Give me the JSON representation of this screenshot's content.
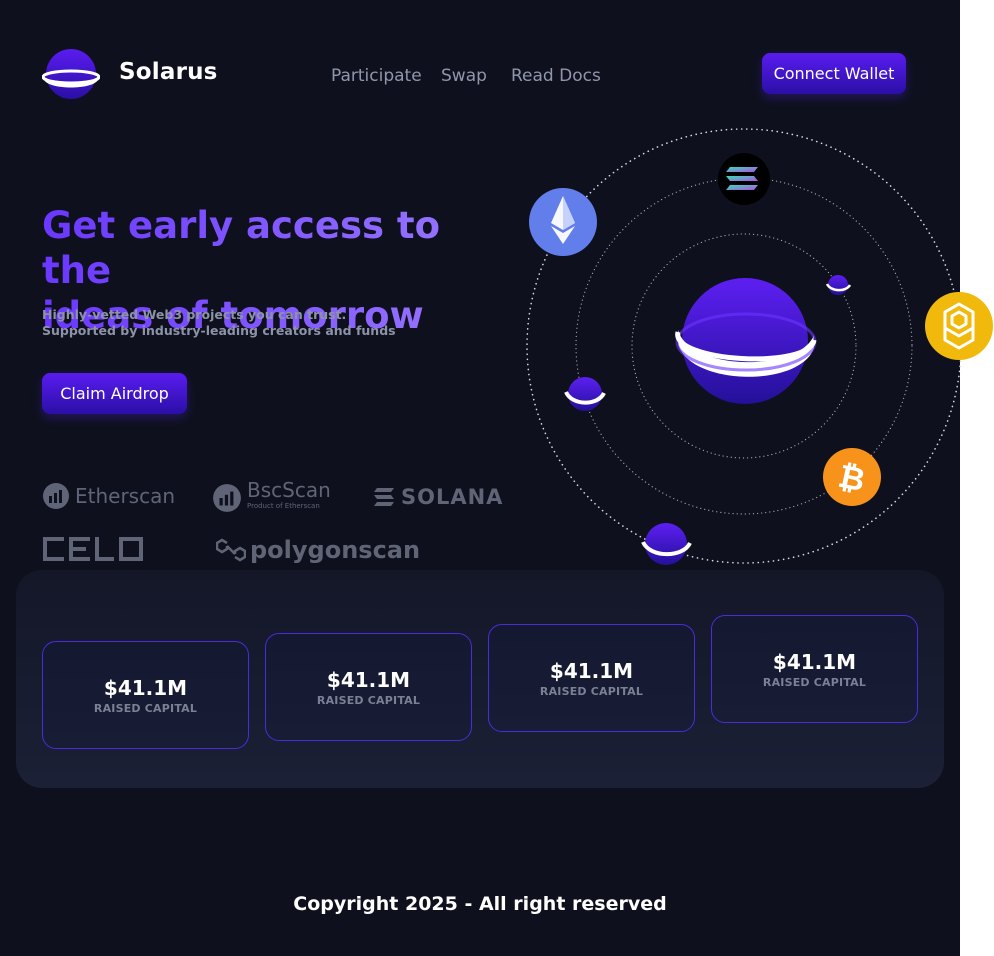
{
  "brand": {
    "name": "Solarus"
  },
  "nav": {
    "items": [
      "Participate",
      "Swap",
      "Read Docs"
    ],
    "connect_label": "Connect Wallet"
  },
  "hero": {
    "title_line1": "Get early access to the",
    "title_line2": "ideas of tomorrow",
    "subtitle_line1": "Highly-vetted Web3 projects you can trust.",
    "subtitle_line2": "Supported by industry-leading creators and funds",
    "cta_label": "Claim Airdrop"
  },
  "partners": {
    "etherscan": "Etherscan",
    "bscscan": "BscScan",
    "bscscan_sub": "Product of Etherscan",
    "solana": "SOLANA",
    "celo": "celo",
    "polygonscan": "polygonscan"
  },
  "stats": [
    {
      "value": "$41.1M",
      "label": "RAISED CAPITAL"
    },
    {
      "value": "$41.1M",
      "label": "RAISED CAPITAL"
    },
    {
      "value": "$41.1M",
      "label": "RAISED CAPITAL"
    },
    {
      "value": "$41.1M",
      "label": "RAISED CAPITAL"
    }
  ],
  "footer": {
    "text": "Copyright 2025 - All right reserved"
  },
  "icons": [
    "planet-icon",
    "ethereum-icon",
    "solana-icon",
    "bnb-icon",
    "bitcoin-icon"
  ],
  "colors": {
    "background": "#0e111d",
    "accent": "#5a1cf0",
    "heading_gradient_start": "#6a37ff",
    "heading_gradient_end": "#9b7bff",
    "ethereum": "#627eea",
    "bnb": "#f0b90b",
    "bitcoin": "#f7931a"
  }
}
